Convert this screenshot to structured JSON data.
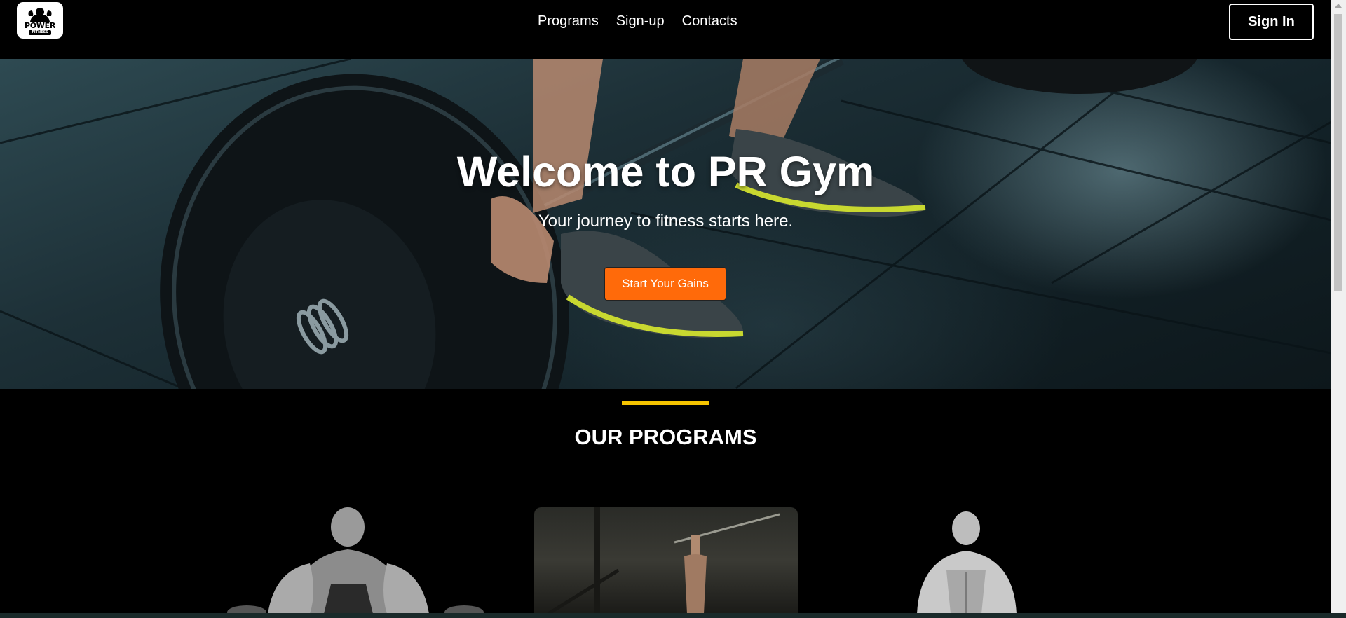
{
  "navbar": {
    "logo": {
      "text": "POWER",
      "sub": "FITNESS",
      "icon": "bodybuilder-logo-icon"
    },
    "links": [
      "Programs",
      "Sign-up",
      "Contacts"
    ],
    "signin_label": "Sign In"
  },
  "hero": {
    "title": "Welcome to PR Gym",
    "subtitle": "Your journey to fitness starts here.",
    "cta_label": "Start Your Gains",
    "cta_color": "#ff6a0a"
  },
  "programs": {
    "title": "OUR PROGRAMS",
    "accent_color": "#f5c400",
    "cards": [
      {
        "image": "deadlift-athlete-photo"
      },
      {
        "image": "pullup-bar-photo"
      },
      {
        "image": "shirtless-athlete-photo"
      }
    ]
  }
}
